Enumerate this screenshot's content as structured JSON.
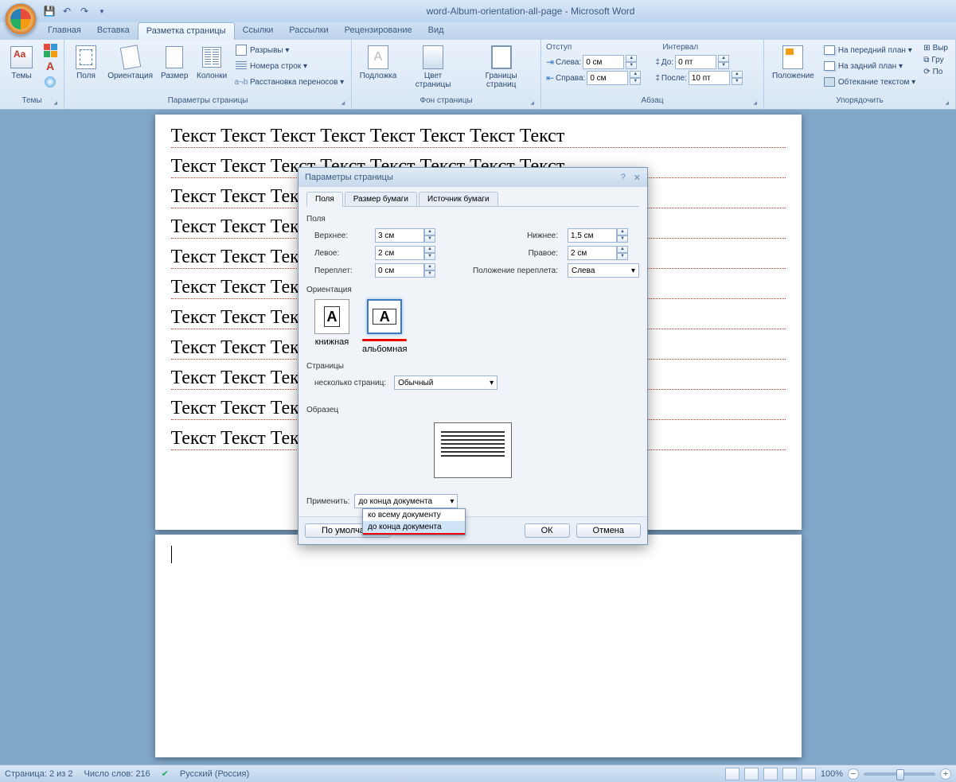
{
  "title": "word-Album-orientation-all-page  -  Microsoft Word",
  "tabs": [
    "Главная",
    "Вставка",
    "Разметка страницы",
    "Ссылки",
    "Рассылки",
    "Рецензирование",
    "Вид"
  ],
  "active_tab": 2,
  "ribbon": {
    "themes": {
      "label": "Темы",
      "btn": "Темы"
    },
    "page_setup": {
      "label": "Параметры страницы",
      "margins": "Поля",
      "orientation": "Ориентация",
      "size": "Размер",
      "columns": "Колонки",
      "breaks": "Разрывы ▾",
      "line_numbers": "Номера строк ▾",
      "hyphenation": "Расстановка переносов ▾"
    },
    "page_bg": {
      "label": "Фон страницы",
      "watermark": "Подложка",
      "color": "Цвет страницы",
      "borders": "Границы страниц"
    },
    "paragraph": {
      "label": "Абзац",
      "indent_hdr": "Отступ",
      "spacing_hdr": "Интервал",
      "left": "Слева:",
      "right": "Справа:",
      "before": "До:",
      "after": "После:",
      "left_v": "0 см",
      "right_v": "0 см",
      "before_v": "0 пт",
      "after_v": "10 пт"
    },
    "arrange": {
      "label": "Упорядочить",
      "position": "Положение",
      "front": "На передний план ▾",
      "back": "На задний план ▾",
      "wrap": "Обтекание текстом ▾",
      "align": "Выр",
      "group": "Гру",
      "rotate": "По"
    }
  },
  "doc_text_word": "Текст",
  "dialog": {
    "title": "Параметры страницы",
    "tabs": [
      "Поля",
      "Размер бумаги",
      "Источник бумаги"
    ],
    "active_tab": 0,
    "sect_margins": "Поля",
    "top": "Верхнее:",
    "top_v": "3 см",
    "bottom": "Нижнее:",
    "bottom_v": "1,5 см",
    "left": "Левое:",
    "left_v": "2 см",
    "right": "Правое:",
    "right_v": "2 см",
    "gutter": "Переплет:",
    "gutter_v": "0 см",
    "gutter_pos": "Положение переплета:",
    "gutter_pos_v": "Слева",
    "sect_orient": "Ориентация",
    "portrait": "книжная",
    "landscape": "альбомная",
    "sect_pages": "Страницы",
    "multi": "несколько страниц:",
    "multi_v": "Обычный",
    "sect_preview": "Образец",
    "apply": "Применить:",
    "apply_v": "до конца документа",
    "apply_options": [
      "ко всему документу",
      "до конца документа"
    ],
    "default_btn": "По умолчани",
    "ok": "ОК",
    "cancel": "Отмена"
  },
  "status": {
    "page": "Страница: 2 из 2",
    "words": "Число слов: 216",
    "lang": "Русский (Россия)",
    "zoom": "100%"
  }
}
